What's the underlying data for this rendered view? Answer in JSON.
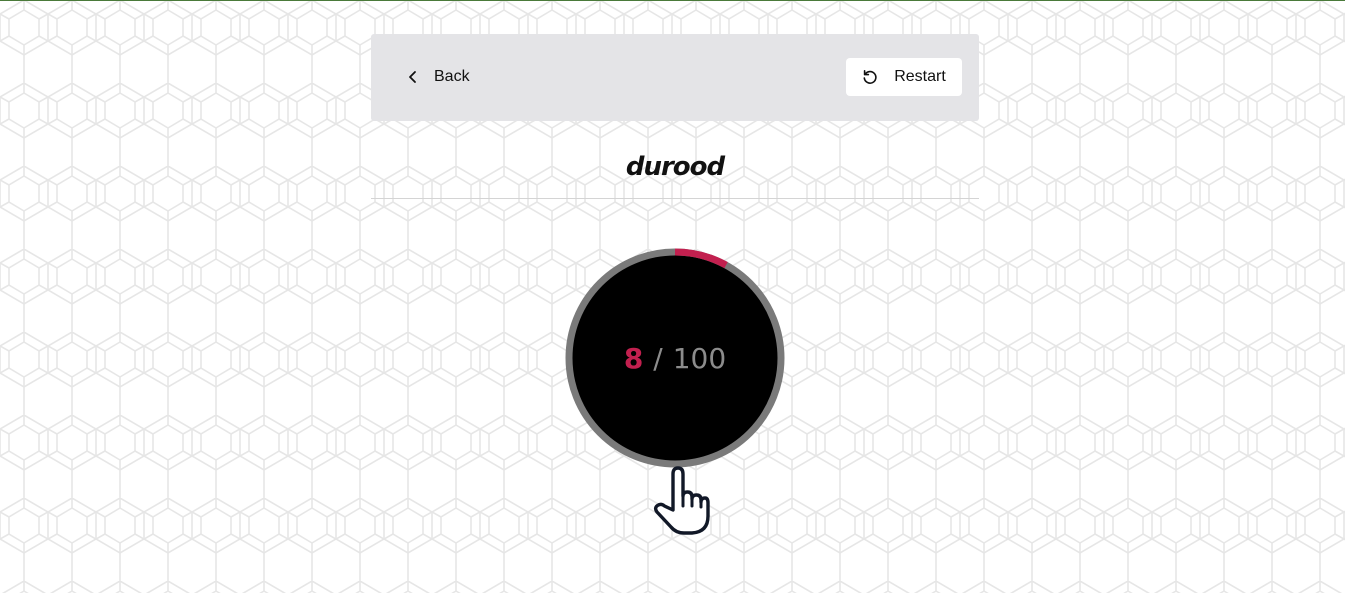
{
  "toolbar": {
    "back_label": "Back",
    "restart_label": "Restart"
  },
  "page": {
    "title": "durood"
  },
  "counter": {
    "current": "8",
    "separator": "/",
    "total": "100",
    "progress_fraction": 0.08
  },
  "icons": {
    "back": "chevron-left-icon",
    "restart": "rotate-ccw-icon",
    "tap": "hand-pointer-icon"
  },
  "colors": {
    "accent": "#c2204f",
    "ring_track": "#7a7a7a",
    "counter_bg": "#000000",
    "toolbar_bg": "#e4e4e7"
  }
}
